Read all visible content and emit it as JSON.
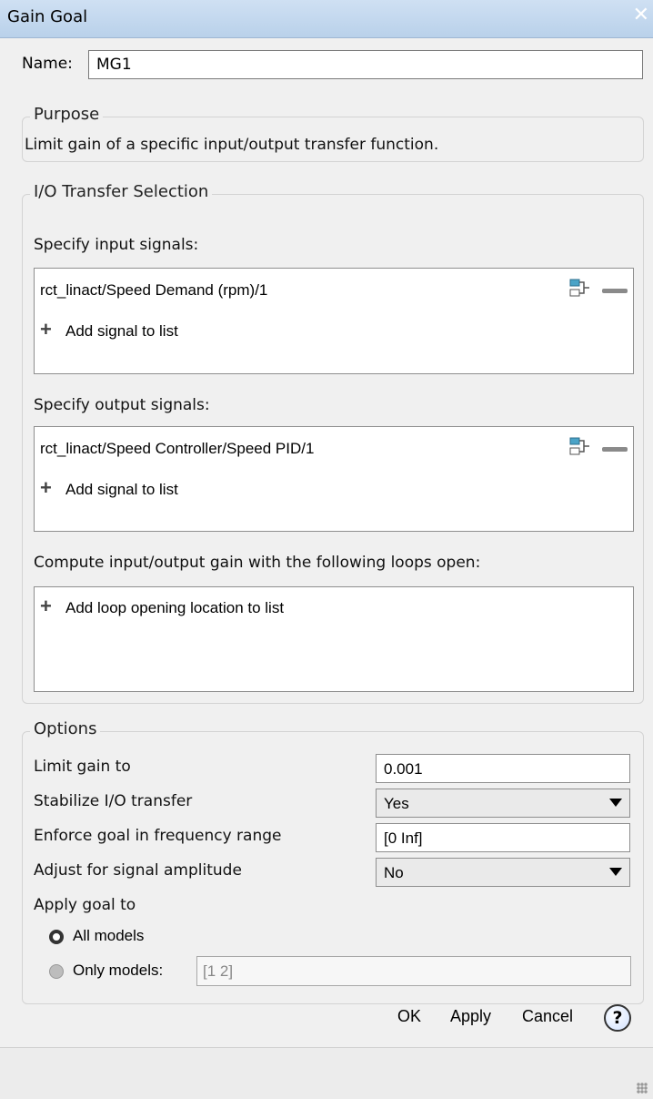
{
  "window": {
    "title": "Gain Goal"
  },
  "name": {
    "label": "Name:",
    "value": "MG1"
  },
  "purpose": {
    "legend": "Purpose",
    "text": "Limit gain of a specific input/output transfer function."
  },
  "io": {
    "legend": "I/O Transfer Selection",
    "inputs_label": "Specify input signals:",
    "input_signal": "rct_linact/Speed Demand (rpm)/1",
    "add_signal": "Add signal to list",
    "outputs_label": "Specify output signals:",
    "output_signal": "rct_linact/Speed Controller/Speed PID/1",
    "loops_label": "Compute input/output gain with the following loops open:",
    "add_loop": "Add loop opening location to list"
  },
  "options": {
    "legend": "Options",
    "limit_label": "Limit gain to",
    "limit_value": "0.001",
    "stabilize_label": "Stabilize I/O transfer",
    "stabilize_value": "Yes",
    "freq_label": "Enforce goal in frequency range",
    "freq_value": "[0 Inf]",
    "amplitude_label": "Adjust for signal amplitude",
    "amplitude_value": "No",
    "apply_label": "Apply goal to",
    "all_models": "All models",
    "only_models": "Only models:",
    "models_value": "[1 2]"
  },
  "footer": {
    "ok": "OK",
    "apply": "Apply",
    "cancel": "Cancel",
    "help": "?"
  },
  "colors": {
    "titlebar": "#c4d8ee",
    "highlight_icon": "#4aa3c7"
  }
}
